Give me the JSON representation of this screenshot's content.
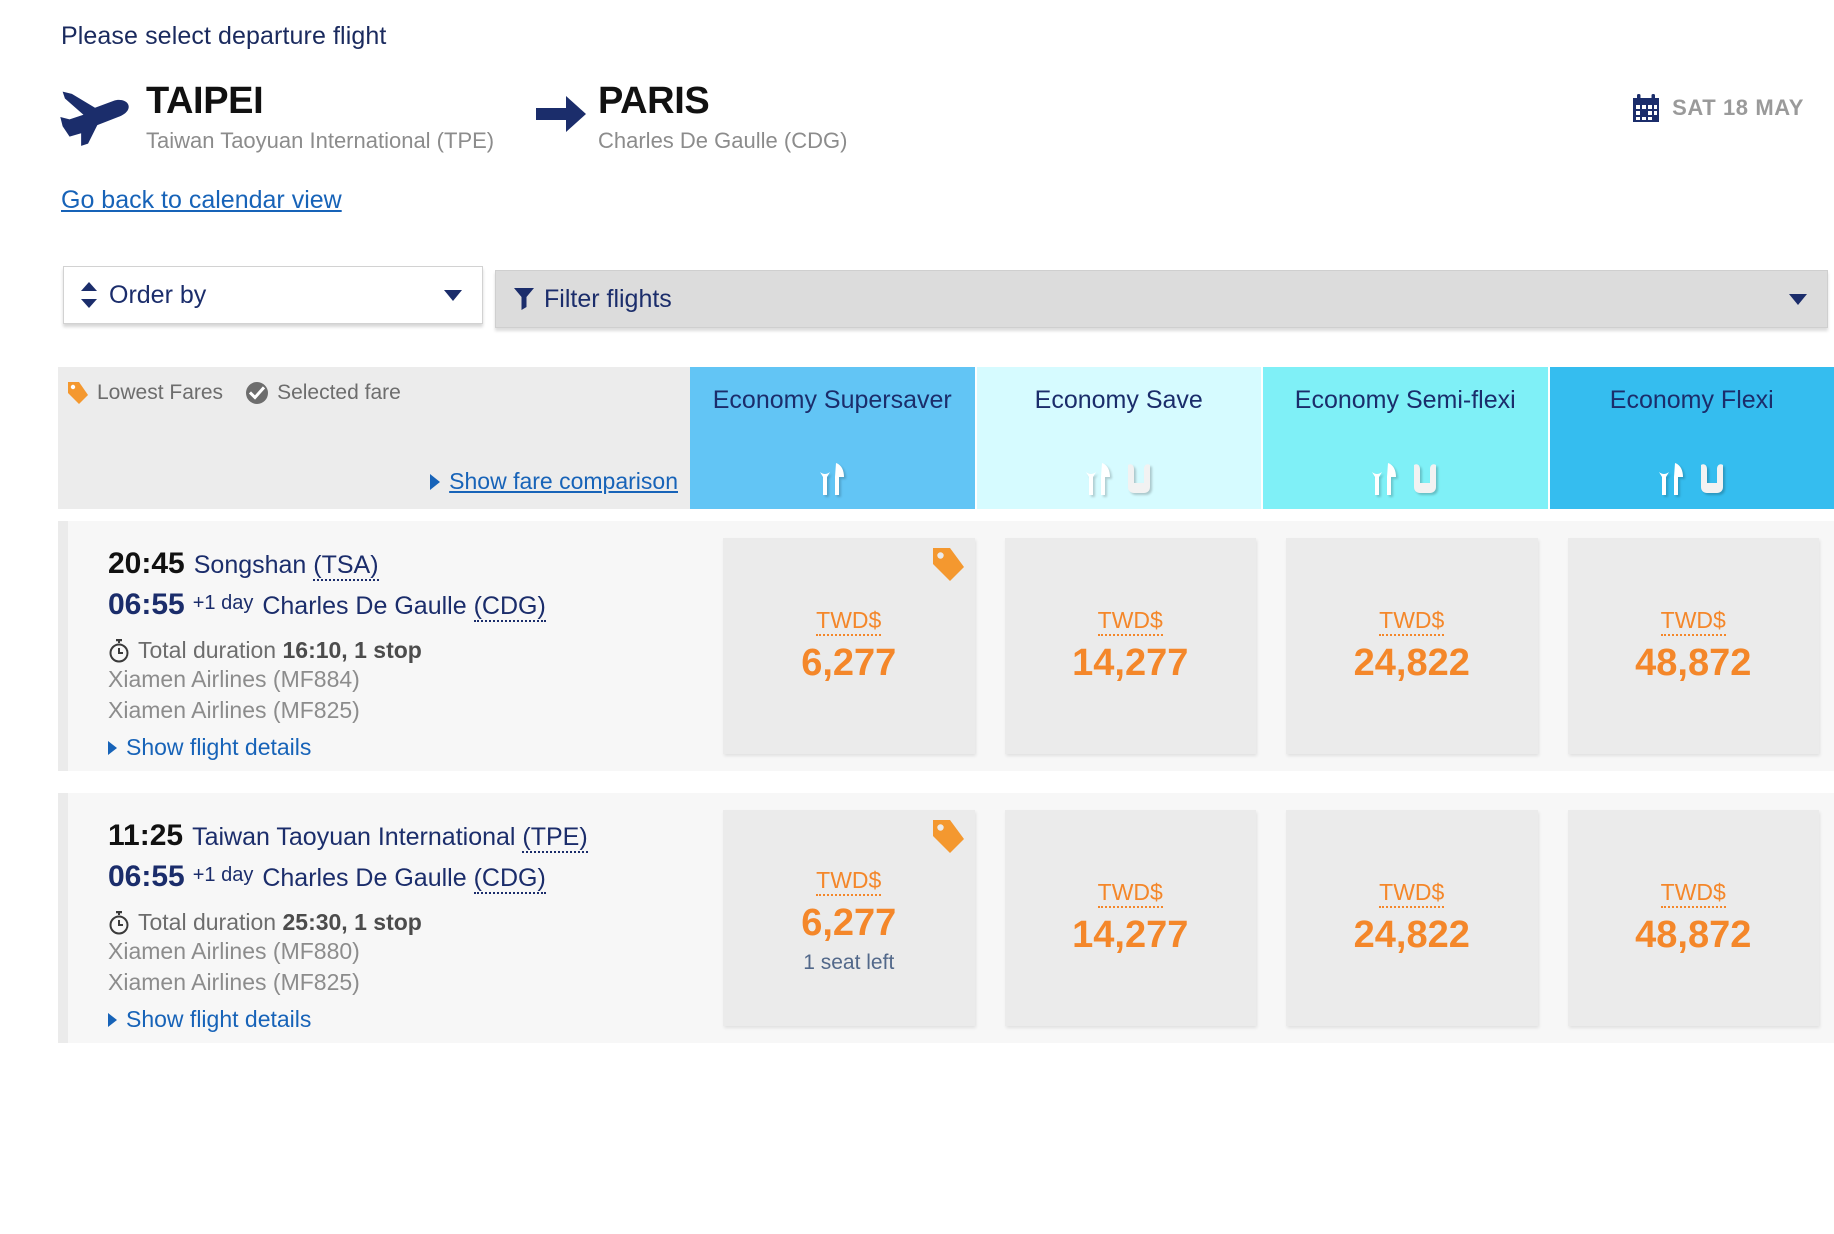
{
  "prompt": "Please select departure flight",
  "route": {
    "plane_icon": "plane-icon",
    "origin": {
      "city": "TAIPEI",
      "airport": "Taiwan Taoyuan International (TPE)"
    },
    "arrow_icon": "arrow-right-icon",
    "destination": {
      "city": "PARIS",
      "airport": "Charles De Gaulle (CDG)"
    },
    "calendar_icon": "calendar-icon",
    "date": "SAT 18 MAY"
  },
  "back_link": "Go back to calendar view",
  "controls": {
    "order_by": {
      "label": "Order by",
      "sort_icon": "sort-updown-icon",
      "caret_icon": "chevron-down-icon"
    },
    "filter": {
      "label": "Filter flights",
      "funnel_icon": "funnel-icon",
      "caret_icon": "chevron-down-icon"
    }
  },
  "legend": {
    "lowest_fares": {
      "label": "Lowest Fares",
      "icon": "price-tag-icon",
      "color": "#f4982f"
    },
    "selected_fare": {
      "label": "Selected fare",
      "icon": "check-circle-icon",
      "color": "#6d6d6d"
    },
    "fare_comparison_link": "Show fare comparison"
  },
  "fare_columns": [
    {
      "title": "Economy Supersaver",
      "bg": "#62c5f5",
      "icons": [
        "meal-icon"
      ]
    },
    {
      "title": "Economy Save",
      "bg": "#d6fbff",
      "icons": [
        "meal-icon",
        "seat-icon"
      ]
    },
    {
      "title": "Economy Semi-flexi",
      "bg": "#7ff0f7",
      "icons": [
        "meal-icon",
        "seat-icon"
      ]
    },
    {
      "title": "Economy Flexi",
      "bg": "#35bdef",
      "icons": [
        "meal-icon",
        "seat-icon"
      ]
    }
  ],
  "currency": "TWD$",
  "flights": [
    {
      "depart_time": "20:45",
      "depart_airport": "Songshan ",
      "depart_code": "(TSA)",
      "arrive_time": "06:55",
      "arrive_day_offset": "+1 day",
      "arrive_airport": "Charles De Gaulle ",
      "arrive_code": "(CDG)",
      "clock_icon": "stopwatch-icon",
      "duration_prefix": "Total duration ",
      "duration_value": "16:10, 1 stop",
      "carriers": [
        "Xiamen Airlines (MF884)",
        "Xiamen Airlines (MF825)"
      ],
      "details_link": "Show flight details",
      "prices": [
        {
          "currency": "TWD$",
          "value": "6,277",
          "lowest": true,
          "tag_icon": "price-tag-icon",
          "note": ""
        },
        {
          "currency": "TWD$",
          "value": "14,277",
          "lowest": false,
          "note": ""
        },
        {
          "currency": "TWD$",
          "value": "24,822",
          "lowest": false,
          "note": ""
        },
        {
          "currency": "TWD$",
          "value": "48,872",
          "lowest": false,
          "note": ""
        }
      ]
    },
    {
      "depart_time": "11:25",
      "depart_airport": "Taiwan Taoyuan International ",
      "depart_code": "(TPE)",
      "arrive_time": "06:55",
      "arrive_day_offset": "+1 day",
      "arrive_airport": "Charles De Gaulle ",
      "arrive_code": "(CDG)",
      "clock_icon": "stopwatch-icon",
      "duration_prefix": "Total duration ",
      "duration_value": "25:30, 1 stop",
      "carriers": [
        "Xiamen Airlines (MF880)",
        "Xiamen Airlines (MF825)"
      ],
      "details_link": "Show flight details",
      "prices": [
        {
          "currency": "TWD$",
          "value": "6,277",
          "lowest": true,
          "tag_icon": "price-tag-icon",
          "note": "1 seat left"
        },
        {
          "currency": "TWD$",
          "value": "14,277",
          "lowest": false,
          "note": ""
        },
        {
          "currency": "TWD$",
          "value": "24,822",
          "lowest": false,
          "note": ""
        },
        {
          "currency": "TWD$",
          "value": "48,872",
          "lowest": false,
          "note": ""
        }
      ]
    }
  ]
}
